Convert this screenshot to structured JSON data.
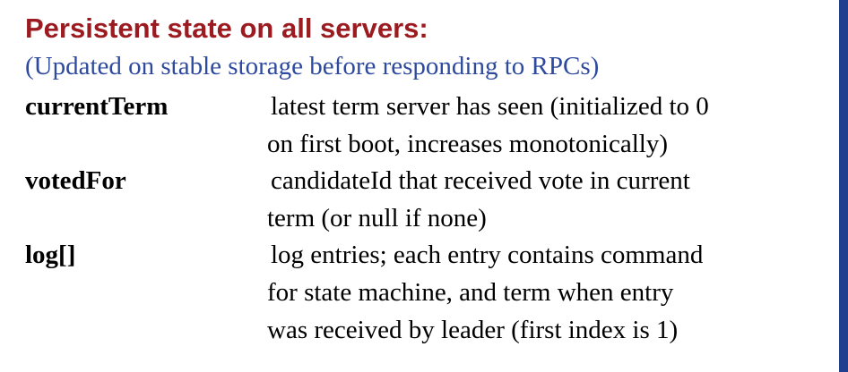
{
  "heading": "Persistent state on all servers:",
  "subheading": "(Updated on stable storage before responding to RPCs)",
  "colors": {
    "heading": "#9b1b20",
    "subheading": "#2e4a9e",
    "border": "#1f3f8f",
    "text": "#000000"
  },
  "fields": [
    {
      "name": "currentTerm",
      "lines": [
        "latest term server has seen (initialized to 0",
        "on first boot, increases monotonically)"
      ]
    },
    {
      "name": "votedFor",
      "lines": [
        "candidateId that received vote in current",
        "term (or null if none)"
      ]
    },
    {
      "name": "log[]",
      "lines": [
        "log entries; each entry contains command",
        "for state machine, and term when entry",
        "was received by leader (first index is 1)"
      ]
    }
  ]
}
